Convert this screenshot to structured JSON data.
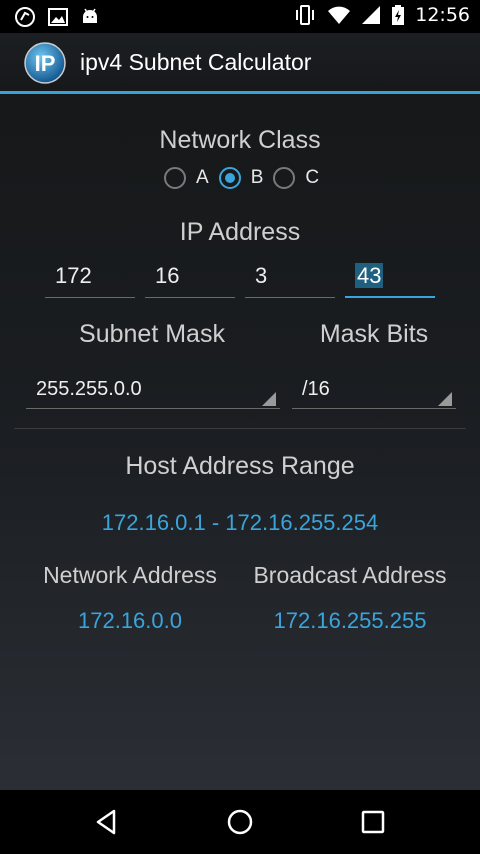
{
  "status_bar": {
    "time": "12:56",
    "left_icons": [
      "sync-icon",
      "image-icon",
      "android-icon"
    ],
    "right_icons": [
      "vibrate-icon",
      "wifi-icon",
      "signal-icon",
      "battery-charging-icon"
    ]
  },
  "action_bar": {
    "logo_text": "IP",
    "title": "ipv4 Subnet Calculator"
  },
  "network_class": {
    "label": "Network Class",
    "options": [
      "A",
      "B",
      "C"
    ],
    "selected": "B"
  },
  "ip_address": {
    "label": "IP Address",
    "octets": [
      "172",
      "16",
      "3",
      "43"
    ]
  },
  "subnet_mask": {
    "label": "Subnet Mask",
    "value": "255.255.0.0"
  },
  "mask_bits": {
    "label": "Mask Bits",
    "value": "/16"
  },
  "host_range": {
    "label": "Host Address Range",
    "value": "172.16.0.1 - 172.16.255.254"
  },
  "network_address": {
    "label": "Network Address",
    "value": "172.16.0.0"
  },
  "broadcast_address": {
    "label": "Broadcast Address",
    "value": "172.16.255.255"
  },
  "nav_bar": {
    "buttons": [
      "back-icon",
      "home-icon",
      "recents-icon"
    ]
  },
  "colors": {
    "accent": "#3aa5dc",
    "background": "#1b1e22"
  }
}
